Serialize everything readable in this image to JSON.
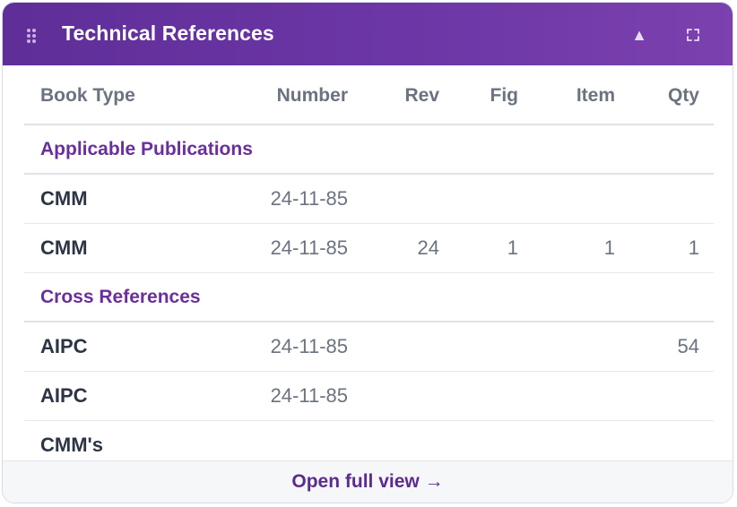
{
  "header": {
    "title": "Technical References",
    "drag_icon": "drag-handle-icon",
    "collapse_icon": "triangle-up-icon",
    "expand_icon": "fullscreen-icon",
    "collapse_glyph": "▲"
  },
  "colors": {
    "header_start": "#5f2e98",
    "header_end": "#7b41ae",
    "section_text": "#6a2f9d",
    "link": "#5c2b8f"
  },
  "columns": [
    "Book Type",
    "Number",
    "Rev",
    "Fig",
    "Item",
    "Qty"
  ],
  "sections": [
    {
      "label": "Applicable Publications",
      "rows": [
        {
          "type": "CMM",
          "number": "24-11-85",
          "rev": "",
          "fig": "",
          "item": "",
          "qty": ""
        },
        {
          "type": "CMM",
          "number": "24-11-85",
          "rev": "24",
          "fig": "1",
          "item": "1",
          "qty": "1"
        }
      ]
    },
    {
      "label": "Cross References",
      "rows": [
        {
          "type": "AIPC",
          "number": "24-11-85",
          "rev": "",
          "fig": "",
          "item": "",
          "qty": "54"
        },
        {
          "type": "AIPC",
          "number": "24-11-85",
          "rev": "",
          "fig": "",
          "item": "",
          "qty": ""
        },
        {
          "type": "CMM's",
          "number": "",
          "rev": "",
          "fig": "",
          "item": "",
          "qty": ""
        }
      ]
    }
  ],
  "footer": {
    "link_label": "Open full view →"
  }
}
